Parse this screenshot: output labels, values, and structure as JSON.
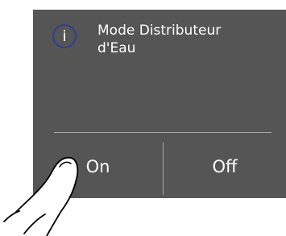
{
  "dialog": {
    "icon": "info-icon",
    "icon_glyph": "i",
    "title_line1": "Mode Distributeur",
    "title_line2": "d'Eau",
    "on_label": "On",
    "off_label": "Off"
  },
  "colors": {
    "screen_background": "#555555",
    "divider": "#a6a6a6",
    "icon_ring": "#2e3f8f",
    "text": "#ffffff"
  },
  "overlay": {
    "icon": "pointing-finger-icon"
  }
}
